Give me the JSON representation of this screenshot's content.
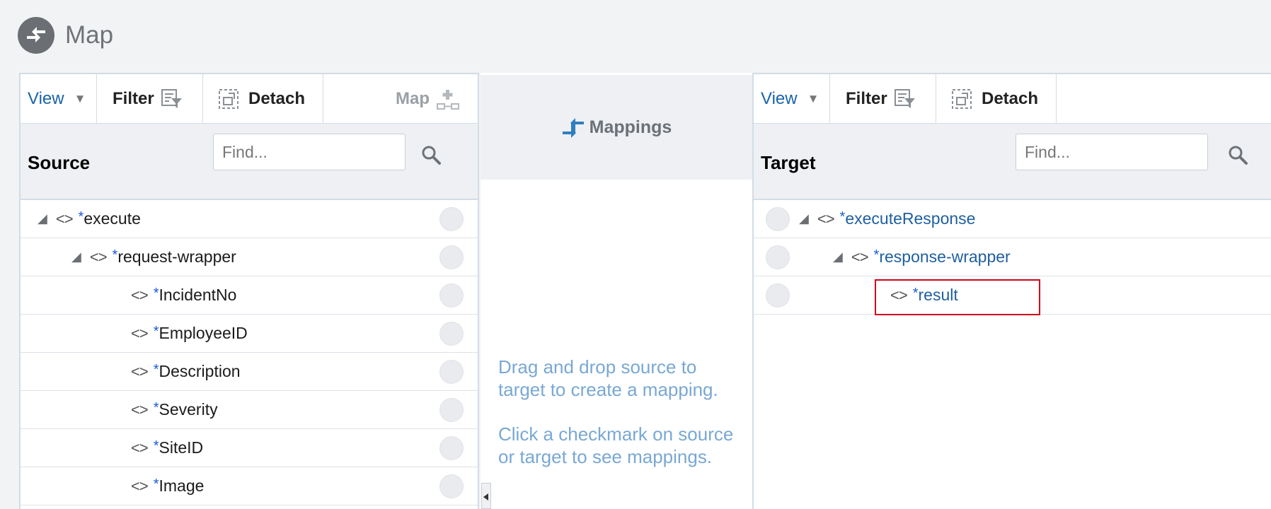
{
  "header": {
    "title": "Map",
    "icon": "map-arrows-icon"
  },
  "source": {
    "toolbar": {
      "view": "View",
      "filter": "Filter",
      "detach": "Detach",
      "map": "Map"
    },
    "title": "Source",
    "find_placeholder": "Find...",
    "rows": [
      {
        "label": "execute"
      },
      {
        "label": "request-wrapper"
      },
      {
        "label": "IncidentNo"
      },
      {
        "label": "EmployeeID"
      },
      {
        "label": "Description"
      },
      {
        "label": "Severity"
      },
      {
        "label": "SiteID"
      },
      {
        "label": "Image"
      }
    ]
  },
  "mappings": {
    "title": "Mappings",
    "help1": "Drag and drop source to target to create a mapping.",
    "help2": "Click a checkmark on source or target to see mappings."
  },
  "target": {
    "toolbar": {
      "view": "View",
      "filter": "Filter",
      "detach": "Detach"
    },
    "title": "Target",
    "find_placeholder": "Find...",
    "rows": [
      {
        "label": "executeResponse"
      },
      {
        "label": "response-wrapper"
      },
      {
        "label": "result"
      }
    ]
  },
  "colors": {
    "link_blue": "#1f5f9f",
    "help_text": "#79a8d4",
    "highlight": "#d0021b"
  },
  "required_marker": "*"
}
